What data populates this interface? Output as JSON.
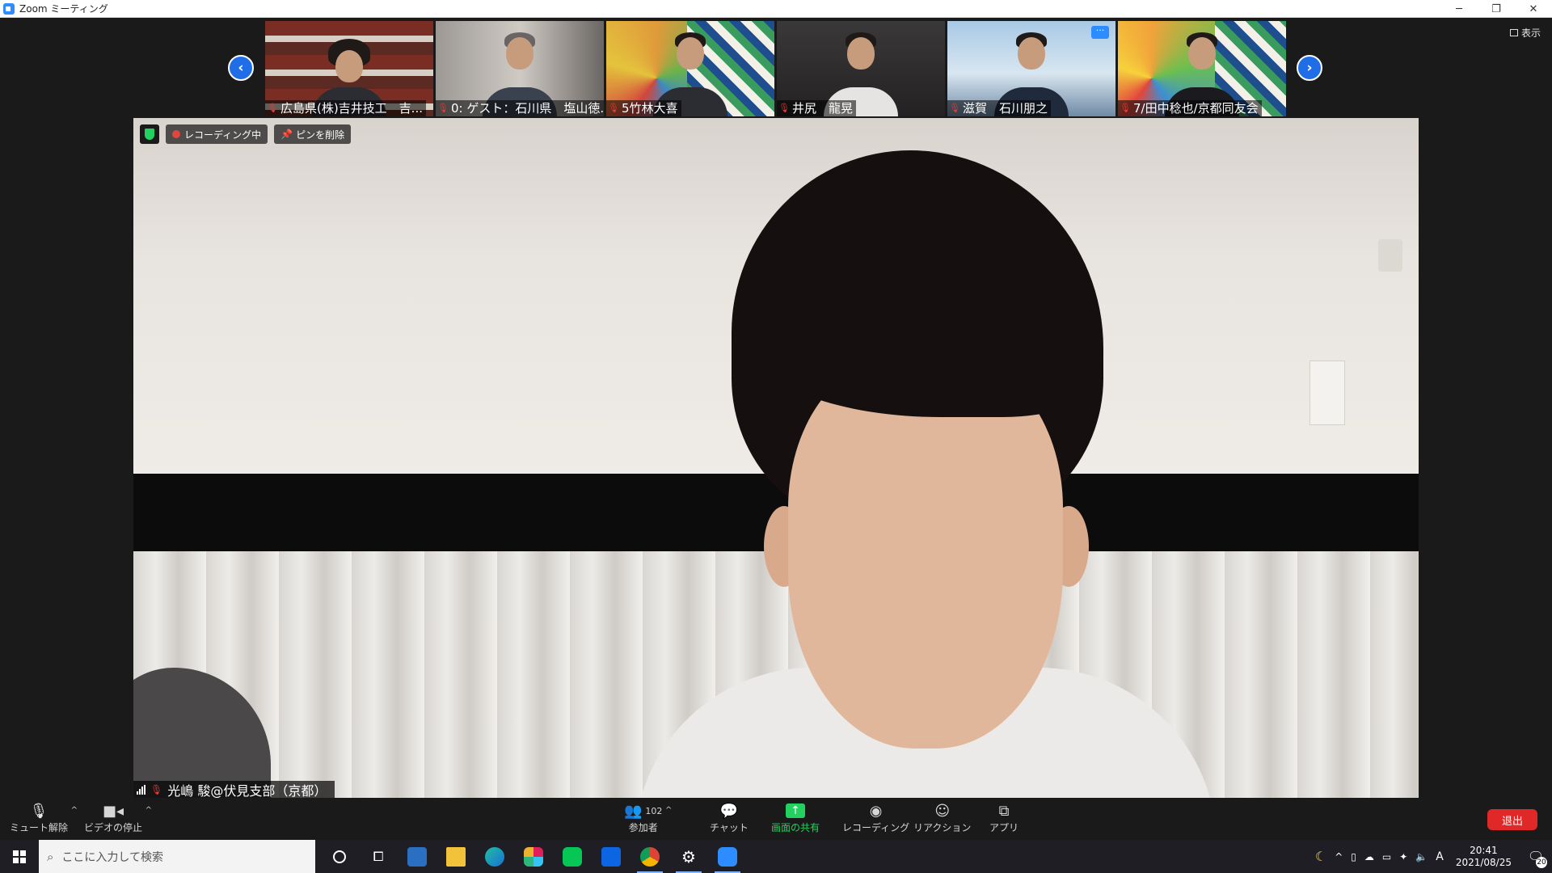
{
  "window": {
    "title": "Zoom ミーティング",
    "controls": {
      "minimize": "─",
      "restore": "❐",
      "close": "✕"
    }
  },
  "view_button": {
    "label": "表示"
  },
  "thumbnails": [
    {
      "name": "広島県(株)吉井技工　吉...",
      "muted": true,
      "bg": "#6b4136"
    },
    {
      "name": "0: ゲスト：石川県　塩山徳...",
      "muted": true,
      "bg": "#8a8684"
    },
    {
      "name": "5竹林大喜",
      "muted": true,
      "bg": "#e8e4d6"
    },
    {
      "name": "井尻　龍晃",
      "muted": true,
      "bg": "#2b2a2b"
    },
    {
      "name": "滋賀　石川朋之",
      "muted": true,
      "bg": "#8fb6d8",
      "has_more_button": true
    },
    {
      "name": "7/田中稔也/京都同友会",
      "muted": true,
      "bg": "#e8e4d6"
    }
  ],
  "thumb_more_button": "···",
  "main_video": {
    "recording_label": "レコーディング中",
    "unpin_label": "ピンを削除",
    "speaker_name": "光嶋 駿@伏見支部（京都）"
  },
  "toolbar": {
    "unmute": "ミュート解除",
    "stop_video": "ビデオの停止",
    "participants": "参加者",
    "participants_count": "102",
    "chat": "チャット",
    "share_screen": "画面の共有",
    "record": "レコーディング",
    "reactions": "リアクション",
    "apps": "アプリ",
    "leave": "退出"
  },
  "taskbar": {
    "search_placeholder": "ここに入力して検索",
    "time": "20:41",
    "date": "2021/08/25",
    "ime": "A",
    "notification_count": "20"
  },
  "colors": {
    "accent": "#2d8cff",
    "share_green": "#23d160",
    "leave_red": "#e02828"
  }
}
